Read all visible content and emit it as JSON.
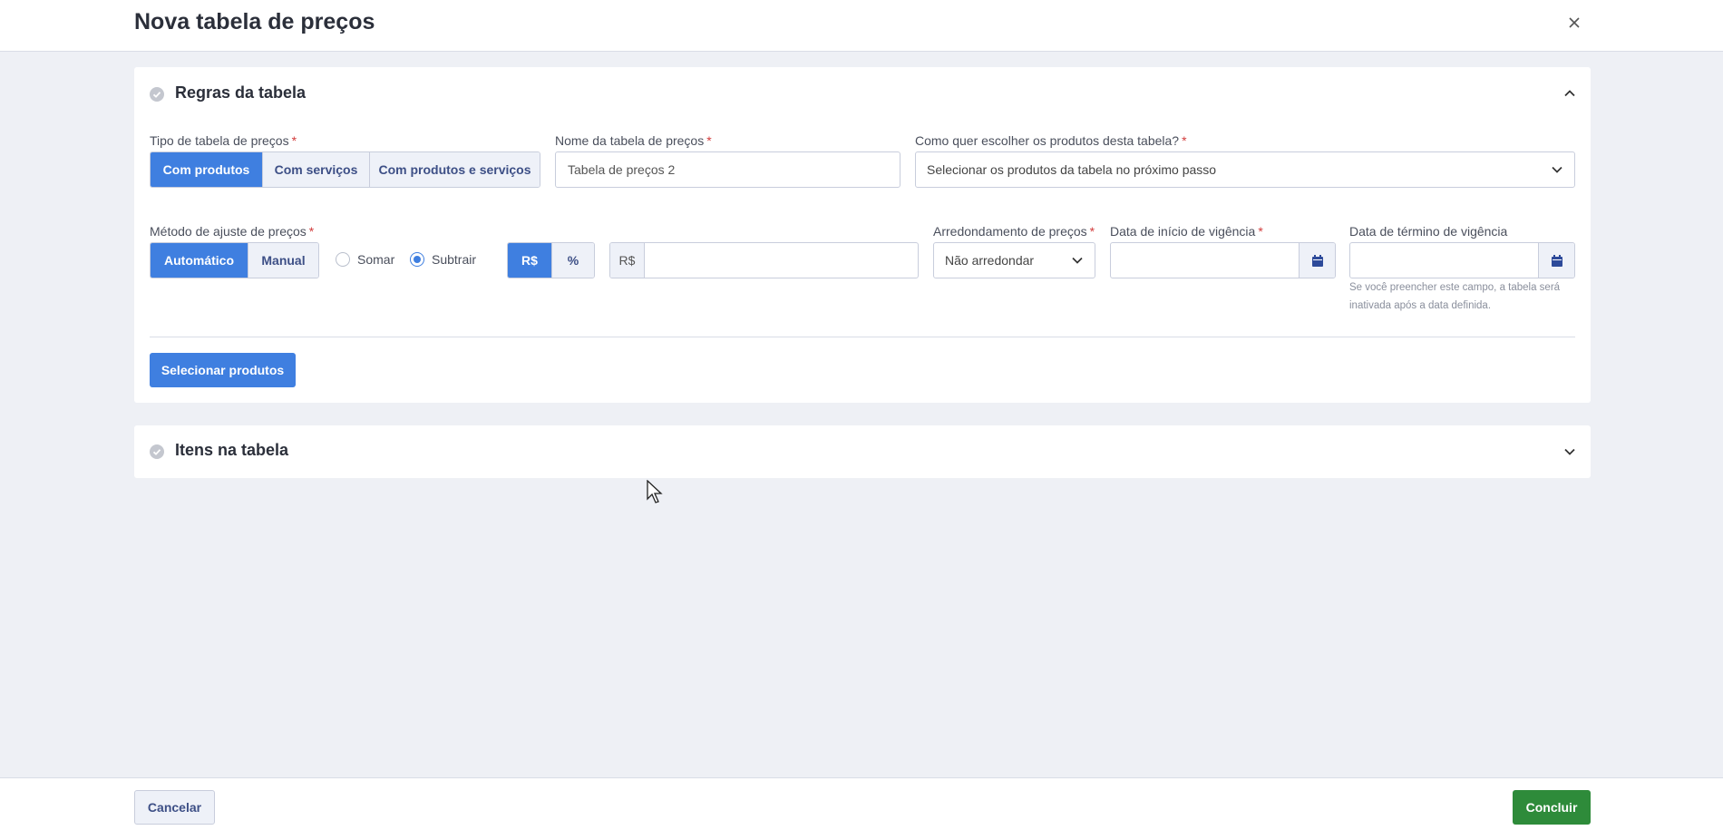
{
  "header": {
    "title": "Nova tabela de preços",
    "close_icon": "close-icon"
  },
  "rules_section": {
    "title": "Regras da tabela",
    "price_table_type": {
      "label": "Tipo de tabela de preços",
      "required_mark": "*",
      "options": [
        "Com produtos",
        "Com serviços",
        "Com produtos e serviços"
      ],
      "selected": "Com produtos"
    },
    "table_name": {
      "label": "Nome da tabela de preços",
      "required_mark": "*",
      "value": "Tabela de preços 2"
    },
    "product_selection": {
      "label": "Como quer escolher os produtos desta tabela?",
      "required_mark": "*",
      "value": "Selecionar os produtos da tabela no próximo passo"
    },
    "adjust_method": {
      "label": "Método de ajuste de preços",
      "required_mark": "*",
      "options": [
        "Automático",
        "Manual"
      ],
      "selected": "Automático"
    },
    "operation": {
      "options": [
        "Somar",
        "Subtrair"
      ],
      "selected": "Subtrair"
    },
    "unit": {
      "options": [
        "R$",
        "%"
      ],
      "selected": "R$"
    },
    "amount": {
      "prefix": "R$",
      "value": ""
    },
    "rounding": {
      "label": "Arredondamento de preços",
      "required_mark": "*",
      "value": "Não arredondar"
    },
    "start_date": {
      "label": "Data de início de vigência",
      "required_mark": "*",
      "value": ""
    },
    "end_date": {
      "label": "Data de término de vigência",
      "value": "",
      "help": "Se você preencher este campo, a tabela será inativada após a data definida."
    },
    "select_products_button": "Selecionar produtos"
  },
  "items_section": {
    "title": "Itens na tabela"
  },
  "footer": {
    "cancel_label": "Cancelar",
    "confirm_label": "Concluir"
  },
  "colors": {
    "primary": "#3f7fe0",
    "success": "#2e8b3a",
    "required": "#d23c3c"
  }
}
